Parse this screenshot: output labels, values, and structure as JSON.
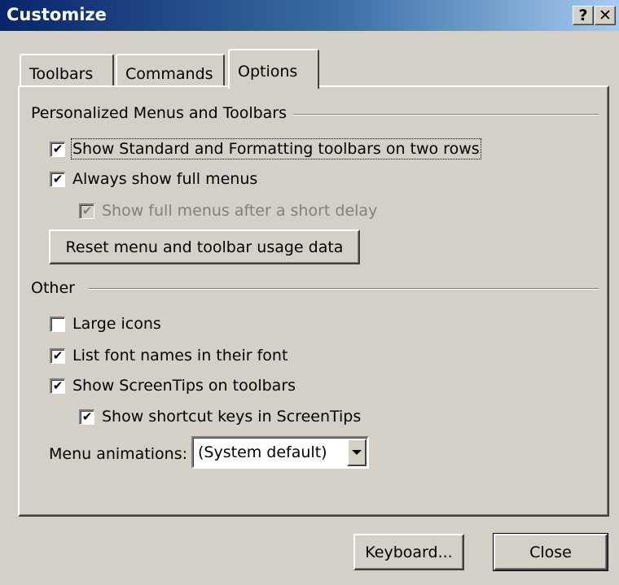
{
  "window": {
    "title": "Customize",
    "help_button": "?",
    "close_button": "✕"
  },
  "tabs": [
    {
      "label": "Toolbars",
      "active": false
    },
    {
      "label": "Commands",
      "active": false
    },
    {
      "label": "Options",
      "active": true
    }
  ],
  "personalized": {
    "heading": "Personalized Menus and Toolbars",
    "two_rows": {
      "label": "Show Standard and Formatting toolbars on two rows",
      "checked": true
    },
    "full_menus": {
      "label": "Always show full menus",
      "checked": true
    },
    "delay": {
      "label": "Show full menus after a short delay",
      "checked": true,
      "enabled": false
    },
    "reset_button": "Reset menu and toolbar usage data"
  },
  "other": {
    "heading": "Other",
    "large_icons": {
      "label": "Large icons",
      "checked": false
    },
    "font_names": {
      "label": "List font names in their font",
      "checked": true
    },
    "screentips": {
      "label": "Show ScreenTips on toolbars",
      "checked": true
    },
    "shortcut_keys": {
      "label": "Show shortcut keys in ScreenTips",
      "checked": true
    },
    "animations_label": "Menu animations:",
    "animations_value": "(System default)"
  },
  "buttons": {
    "keyboard": "Keyboard...",
    "close": "Close"
  },
  "check_glyph": "✔"
}
